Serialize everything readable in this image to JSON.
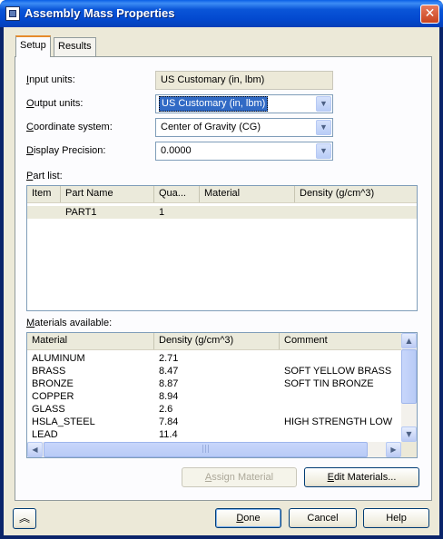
{
  "window": {
    "title": "Assembly Mass Properties",
    "close_label": "✕"
  },
  "tabs": [
    {
      "label": "Setup",
      "active": true
    },
    {
      "label": "Results",
      "active": false
    }
  ],
  "fields": {
    "input_units": {
      "label_pre": "",
      "label_u": "I",
      "label_post": "nput units:",
      "value": "US Customary (in, lbm)"
    },
    "output_units": {
      "label_pre": "",
      "label_u": "O",
      "label_post": "utput units:",
      "value": "US Customary (in, lbm)"
    },
    "coordinate_system": {
      "label_pre": "",
      "label_u": "C",
      "label_post": "oordinate system:",
      "value": "Center of Gravity (CG)"
    },
    "display_precision": {
      "label_pre": "",
      "label_u": "D",
      "label_post": "isplay Precision:",
      "value": "0.0000"
    }
  },
  "part_list": {
    "label_u": "P",
    "label_post": "art list:",
    "columns": [
      "Item",
      "Part Name",
      "Qua...",
      "Material",
      "Density (g/cm^3)"
    ],
    "rows": [
      {
        "item": "",
        "name": "PART1",
        "qty": "1",
        "material": "",
        "density": ""
      }
    ]
  },
  "materials": {
    "label_u": "M",
    "label_post": "aterials available:",
    "columns": [
      "Material",
      "Density (g/cm^3)",
      "Comment"
    ],
    "rows": [
      {
        "material": "ALUMINUM",
        "density": "2.71",
        "comment": ""
      },
      {
        "material": "BRASS",
        "density": "8.47",
        "comment": "SOFT YELLOW BRASS"
      },
      {
        "material": "BRONZE",
        "density": "8.87",
        "comment": "SOFT TIN BRONZE"
      },
      {
        "material": "COPPER",
        "density": "8.94",
        "comment": ""
      },
      {
        "material": "GLASS",
        "density": "2.6",
        "comment": ""
      },
      {
        "material": "HSLA_STEEL",
        "density": "7.84",
        "comment": "HIGH STRENGTH LOW"
      },
      {
        "material": "LEAD",
        "density": "11.4",
        "comment": ""
      }
    ]
  },
  "buttons": {
    "assign_material_u": "A",
    "assign_material_post": "ssign Material",
    "edit_materials_u": "E",
    "edit_materials_post": "dit Materials...",
    "done_u": "D",
    "done_post": "one",
    "cancel": "Cancel",
    "help": "Help"
  },
  "icons": {
    "collapse": "double-chevron-up-icon",
    "dropdown": "chevron-down-icon"
  }
}
